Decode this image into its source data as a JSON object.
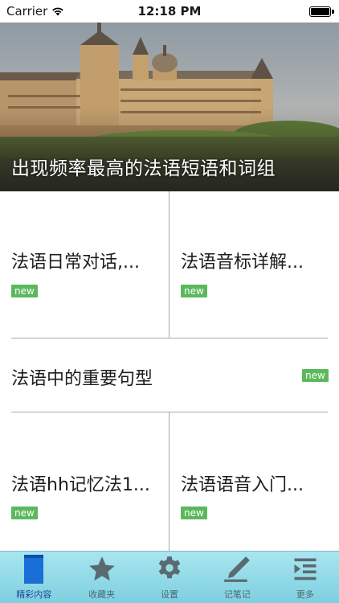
{
  "status_bar": {
    "carrier": "Carrier",
    "time": "12:18 PM",
    "battery_level": 1.0
  },
  "hero": {
    "title": "出现频率最高的法语短语和词组"
  },
  "grid": {
    "cells": [
      {
        "title": "法语日常对话,...",
        "badge": "new"
      },
      {
        "title": "法语音标详解...",
        "badge": "new"
      },
      {
        "title": "法语中的重要句型",
        "badge": "new"
      },
      {
        "title": "法语hh记忆法1...",
        "badge": "new"
      },
      {
        "title": "法语语音入门...",
        "badge": "new"
      }
    ]
  },
  "tab_bar": {
    "items": [
      {
        "label": "精彩内容",
        "icon": "document-icon",
        "active": true
      },
      {
        "label": "收藏夹",
        "icon": "star-icon",
        "active": false
      },
      {
        "label": "设置",
        "icon": "gear-icon",
        "active": false
      },
      {
        "label": "记笔记",
        "icon": "pen-icon",
        "active": false
      },
      {
        "label": "更多",
        "icon": "more-list-icon",
        "active": false
      }
    ]
  },
  "colors": {
    "badge": "#5cb85c",
    "tab_bar_top": "#a8e6ef",
    "tab_bar_bottom": "#7ecfe0",
    "active_tab": "#1a6fd6"
  }
}
